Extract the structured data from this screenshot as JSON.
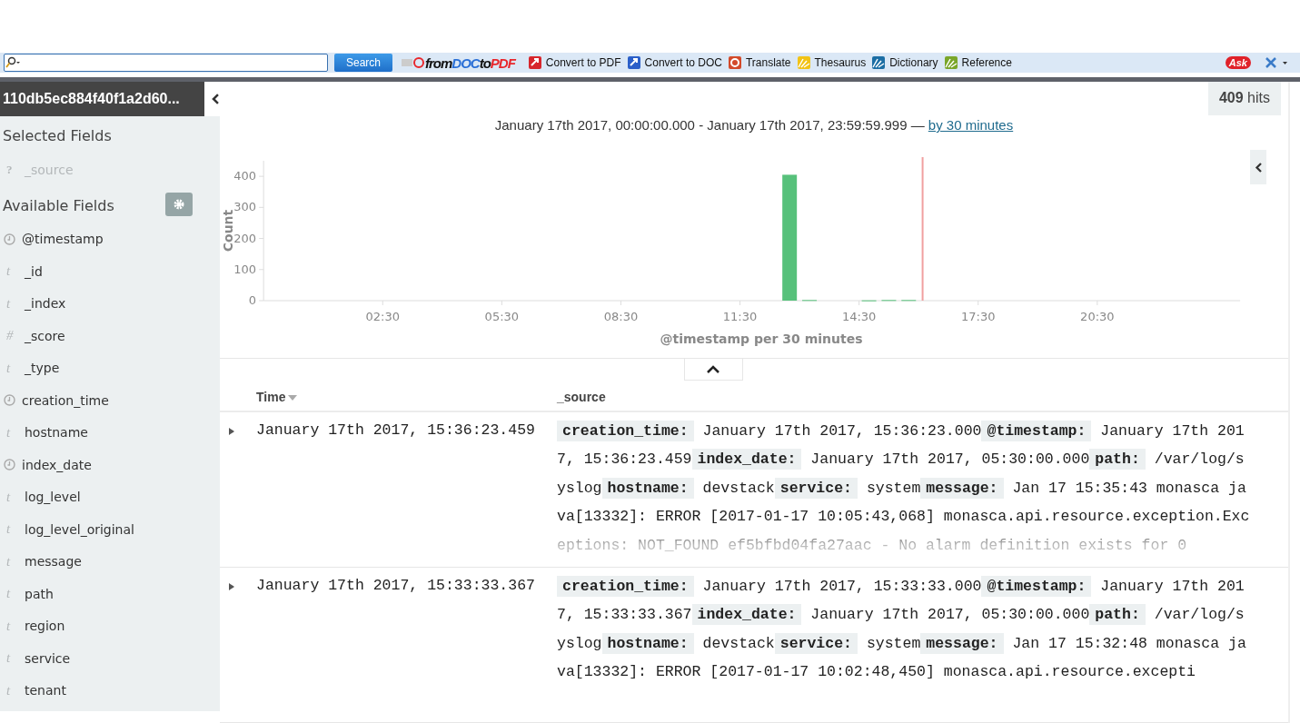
{
  "toolbar": {
    "search_button": "Search",
    "logo_parts": [
      {
        "text": "from",
        "color": "#111111"
      },
      {
        "text": "DOC",
        "color": "#2a6fd6"
      },
      {
        "text": "to",
        "color": "#111111"
      },
      {
        "text": "PDF",
        "color": "#e8262b"
      }
    ],
    "items": [
      {
        "label": "Convert to PDF",
        "kind": "pdf"
      },
      {
        "label": "Convert to DOC",
        "kind": "doc"
      },
      {
        "label": "Translate",
        "kind": "translate"
      },
      {
        "label": "Thesaurus",
        "kind": "thesaurus"
      },
      {
        "label": "Dictionary",
        "kind": "dictionary"
      },
      {
        "label": "Reference",
        "kind": "reference"
      }
    ],
    "ask_logo": "Ask"
  },
  "sidebar": {
    "index_title": "110db5ec884f40f1a2d60...",
    "selected_heading": "Selected Fields",
    "selected_fields": [
      {
        "type_label": "?",
        "name": "_source",
        "kind": "unknown"
      }
    ],
    "available_heading": "Available Fields",
    "available_fields": [
      {
        "name": "@timestamp",
        "kind": "date"
      },
      {
        "type_label": "t",
        "name": "_id",
        "kind": "string"
      },
      {
        "type_label": "t",
        "name": "_index",
        "kind": "string"
      },
      {
        "type_label": "#",
        "name": "_score",
        "kind": "number"
      },
      {
        "type_label": "t",
        "name": "_type",
        "kind": "string"
      },
      {
        "name": "creation_time",
        "kind": "date"
      },
      {
        "type_label": "t",
        "name": "hostname",
        "kind": "string"
      },
      {
        "name": "index_date",
        "kind": "date"
      },
      {
        "type_label": "t",
        "name": "log_level",
        "kind": "string"
      },
      {
        "type_label": "t",
        "name": "log_level_original",
        "kind": "string"
      },
      {
        "type_label": "t",
        "name": "message",
        "kind": "string"
      },
      {
        "type_label": "t",
        "name": "path",
        "kind": "string"
      },
      {
        "type_label": "t",
        "name": "region",
        "kind": "string"
      },
      {
        "type_label": "t",
        "name": "service",
        "kind": "string"
      },
      {
        "type_label": "t",
        "name": "tenant",
        "kind": "string"
      }
    ]
  },
  "hits": "**409** hits",
  "time_range": {
    "text": "January 17th 2017, 00:00:00.000 - January 17th 2017, 23:59:59.999 —",
    "interval_link": "by 30 minutes"
  },
  "histogram": {
    "chart_data": {
      "type": "bar",
      "xlabel": "@timestamp per 30 minutes",
      "ylabel": "Count",
      "x": [
        12.75,
        13.25,
        14.75,
        15.25,
        15.75
      ],
      "values": [
        405,
        2,
        1,
        2,
        2
      ],
      "xlim": [
        -0.5,
        24.1
      ],
      "ylim": [
        0,
        450
      ],
      "xticks": [
        {
          "value": 2.5,
          "label": "02:30"
        },
        {
          "value": 5.5,
          "label": "05:30"
        },
        {
          "value": 8.5,
          "label": "08:30"
        },
        {
          "value": 11.5,
          "label": "11:30"
        },
        {
          "value": 14.5,
          "label": "14:30"
        },
        {
          "value": 17.5,
          "label": "17:30"
        },
        {
          "value": 20.5,
          "label": "20:30"
        }
      ],
      "yticks": [
        0,
        100,
        200,
        300,
        400
      ],
      "ref_lines": [
        {
          "axis": "x",
          "value": 16.1
        }
      ]
    }
  },
  "table": {
    "columns": [
      {
        "label": "Time",
        "sorted": true
      },
      {
        "label": "_source",
        "sorted": false
      }
    ],
    "rows": [
      {
        "expanded": false,
        "time": "January 17th 2017, 15:36:23.459",
        "source": [
          {
            "key": "creation_time:",
            "value": "January 17th 2017, 15:36:23.000"
          },
          {
            "key": "@timestamp:",
            "value": "January 17th 2017, 15:36:23.459"
          },
          {
            "key": "index_date:",
            "value": "January 17th 2017, 05:30:00.000"
          },
          {
            "key": "path:",
            "value": "/var/log/syslog"
          },
          {
            "key": "hostname:",
            "value": "devstack"
          },
          {
            "key": "service:",
            "value": "system"
          },
          {
            "key": "message:",
            "value": "Jan 17 15:35:43 monasca java[13332]: ERROR [2017-01-17 10:05:43,068] monasca.api.resource.exception.Exceptions: NOT_FOUND ef5bfbd04fa27aac - No alarm definition exists for 0"
          }
        ]
      },
      {
        "expanded": false,
        "time": "January 17th 2017, 15:33:33.367",
        "source": [
          {
            "key": "creation_time:",
            "value": "January 17th 2017, 15:33:33.000"
          },
          {
            "key": "@timestamp:",
            "value": "January 17th 2017, 15:33:33.367"
          },
          {
            "key": "index_date:",
            "value": "January 17th 2017, 05:30:00.000"
          },
          {
            "key": "path:",
            "value": "/var/log/syslog"
          },
          {
            "key": "hostname:",
            "value": "devstack"
          },
          {
            "key": "service:",
            "value": "system"
          },
          {
            "key": "message:",
            "value": "Jan 17 15:32:48 monasca java[13332]: ERROR [2017-01-17 10:02:48,450] monasca.api.resource.excepti"
          }
        ]
      }
    ]
  }
}
